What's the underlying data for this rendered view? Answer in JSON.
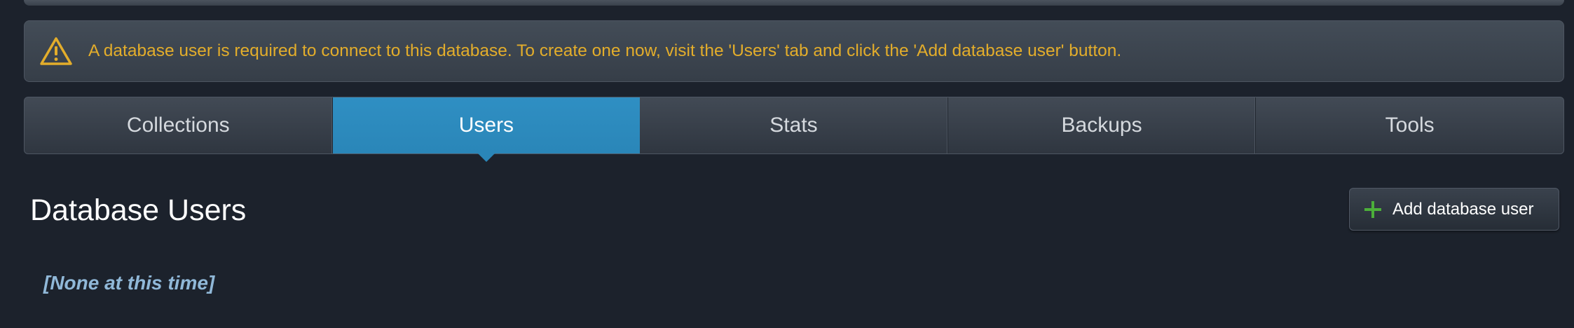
{
  "alert": {
    "icon": "warning-triangle-icon",
    "color": "#e3ad2b",
    "message": "A database user is required to connect to this database. To create one now, visit the 'Users' tab and click the 'Add database user' button."
  },
  "tabs": [
    {
      "label": "Collections",
      "active": false
    },
    {
      "label": "Users",
      "active": true
    },
    {
      "label": "Stats",
      "active": false
    },
    {
      "label": "Backups",
      "active": false
    },
    {
      "label": "Tools",
      "active": false
    }
  ],
  "accent_color": "#2a86b8",
  "section": {
    "title": "Database Users",
    "add_button_label": "Add database user",
    "add_button_icon": "plus-icon",
    "empty_text": "[None at this time]"
  }
}
